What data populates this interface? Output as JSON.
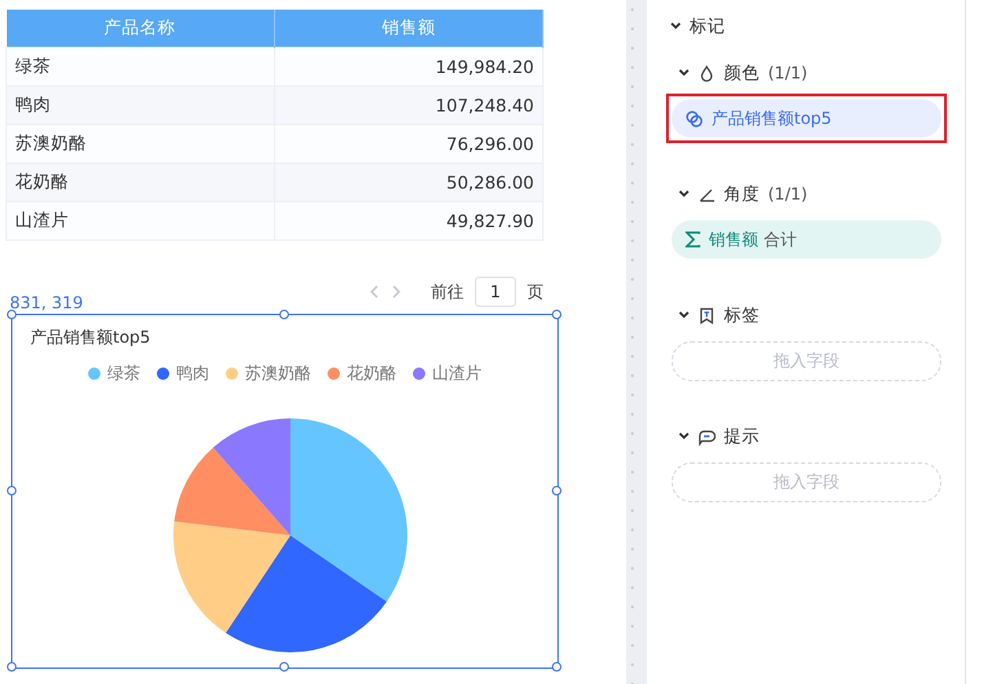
{
  "table": {
    "columns": [
      "产品名称",
      "销售额"
    ],
    "rows": [
      [
        "绿茶",
        "149,984.20"
      ],
      [
        "鸭肉",
        "107,248.40"
      ],
      [
        "苏澳奶酪",
        "76,296.00"
      ],
      [
        "花奶酪",
        "50,286.00"
      ],
      [
        "山渣片",
        "49,827.90"
      ]
    ]
  },
  "pagination": {
    "prefix": "前往",
    "page": "1",
    "suffix": "页"
  },
  "chart_widget": {
    "coords": "831, 319",
    "selected": true,
    "chart_data": {
      "type": "pie",
      "title": "产品销售额top5",
      "categories": [
        "绿茶",
        "鸭肉",
        "苏澳奶酪",
        "花奶酪",
        "山渣片"
      ],
      "colors": [
        "#65c5ff",
        "#3067ff",
        "#ffcd86",
        "#ff8e62",
        "#8a78ff"
      ],
      "legend": true,
      "values": [
        34.59,
        24.73,
        17.59,
        11.6,
        11.49
      ]
    }
  },
  "marks_panel": {
    "title": "标记",
    "expanded": true,
    "sections": [
      {
        "kind": "color",
        "label": "颜色",
        "count": "(1/1)",
        "expanded": true,
        "fields": [
          {
            "kind": "dimension",
            "label": "产品销售额top5",
            "highlighted": true
          }
        ]
      },
      {
        "kind": "angle",
        "label": "角度",
        "count": "(1/1)",
        "expanded": true,
        "fields": [
          {
            "kind": "measure",
            "label": "销售额",
            "aggregate": "合计",
            "highlighted": false
          }
        ]
      },
      {
        "kind": "label",
        "label": "标签",
        "expanded": true,
        "placeholder": "拖入字段"
      },
      {
        "kind": "tooltip",
        "label": "提示",
        "expanded": true,
        "placeholder": "拖入字段"
      }
    ]
  }
}
